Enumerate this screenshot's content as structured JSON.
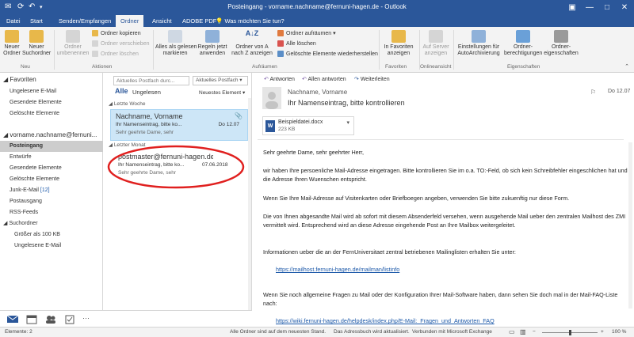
{
  "window": {
    "title": "Posteingang - vorname.nachname@fernuni-hagen.de - Outlook"
  },
  "tabs": [
    "Datei",
    "Start",
    "Senden/Empfangen",
    "Ordner",
    "Ansicht",
    "ADOBE PDF"
  ],
  "tell_me": "Was möchten Sie tun?",
  "ribbon": {
    "neuer_ordner": "Neuer\nOrdner",
    "neuer_suchordner": "Neuer\nSuchordner",
    "ordner_umbenennen": "Ordner\numbenennen",
    "ordner_kopieren": "Ordner kopieren",
    "ordner_verschieben": "Ordner verschieben",
    "ordner_loeschen": "Ordner löschen",
    "alle_gelesen": "Alles als gelesen\nmarkieren",
    "regeln_jetzt": "Regeln jetzt\nanwenden",
    "ordner_sortieren": "Ordner von A\nnach Z anzeigen",
    "ordner_aufraeumen": "Ordner aufräumen",
    "alle_loeschen": "Alle löschen",
    "geloeschte_wiederherstellen": "Gelöschte Elemente wiederherstellen",
    "in_favoriten": "In Favoriten\nanzeigen",
    "auf_server": "Auf Server\nanzeigen",
    "einstellungen_archiv": "Einstellungen für\nAutoArchivierung",
    "ordnerberechtigungen": "Ordner-\nberechtigungen",
    "ordnereigenschaften": "Ordner-\neigenschaften",
    "groups": [
      "Neu",
      "Aktionen",
      "Aufräumen",
      "Favoriten",
      "Onlineansicht",
      "Eigenschaften"
    ]
  },
  "folders": {
    "favoriten": "Favoriten",
    "fav_items": [
      "Ungelesene E-Mail",
      "Gesendete Elemente",
      "Gelöschte Elemente"
    ],
    "account": "vorname.nachname@fernuni...",
    "items": [
      "Posteingang",
      "Entwürfe",
      "Gesendete Elemente",
      "Gelöschte Elemente",
      "Junk-E-Mail",
      "Postausgang",
      "RSS-Feeds",
      "Suchordner"
    ],
    "junk_count": "[12]",
    "search_items": [
      "Größer als 100 KB",
      "Ungelesene E-Mail"
    ]
  },
  "msglist": {
    "search_placeholder": "Aktuelles Postfach durc...",
    "scope": "Aktuelles Postfach",
    "filter_all": "Alle",
    "filter_unread": "Ungelesen",
    "sort": "Neuestes Element",
    "group1": "Letzte Woche",
    "group2": "Letzter Monat",
    "mail1": {
      "from": "Nachname, Vorname",
      "subject": "Ihr Namenseintrag, bitte ko...",
      "preview": "Sehr geehrte Dame, sehr",
      "date": "Do 12.07"
    },
    "mail2": {
      "from": "postmaster@fernuni-hagen.de",
      "subject": "Ihr Namenseintrag, bitte ko...",
      "preview": "Sehr geehrte Dame, sehr",
      "date": "07.06.2018"
    }
  },
  "reading": {
    "reply": "Antworten",
    "reply_all": "Allen antworten",
    "forward": "Weiterleiten",
    "sender": "Nachname, Vorname",
    "date": "Do 12.07",
    "subject": "Ihr Namenseintrag, bitte kontrollieren",
    "attachment_name": "Beispieldatei.docx",
    "attachment_size": "223 KB",
    "p1": "Sehr geehrte Dame, sehr geehrter Herr,",
    "p2": "wir haben Ihre persoenliche Mail-Adresse eingetragen. Bitte kontrollieren Sie im o.a. TO:-Feld, ob sich kein Schreibfehler eingeschlichen hat und die Adresse Ihren Wuenschen entspricht.",
    "p3": "Wenn Sie Ihre Mail-Adresse auf Visitenkarten oder Briefboegen angeben, verwenden Sie bitte zukuenftig nur diese Form.",
    "p4": "Die von Ihnen abgesandte Mail wird ab sofort mit diesem Absenderfeld versehen, wenn ausgehende Mail ueber den zentralen Mailhost des ZMI vermittelt wird. Entsprechend wird an diese Adresse eingehende Post an Ihre Mailbox weitergeleitet.",
    "p5": "Informationen ueber die an der FernUniversitaet zentral betriebenen Mailinglisten erhalten Sie unter:",
    "link1": "https://mailhost.fernuni-hagen.de/mailman/listinfo",
    "p6": "Wenn Sie noch allgemeine Fragen zu Mail oder der Konfiguration Ihrer Mail-Software haben, dann sehen Sie doch mal in der Mail-FAQ-Liste nach:",
    "link2": "https://wiki.fernuni-hagen.de/helpdesk/index.php/E-Mail:_Fragen_und_Antworten_FAQ"
  },
  "status": {
    "elements": "Elemente: 2",
    "sync": "Alle Ordner sind auf dem neuesten Stand.",
    "addressbook": "Das Adressbuch wird aktualisiert.",
    "connection": "Verbunden mit Microsoft Exchange",
    "zoom": "100 %"
  }
}
